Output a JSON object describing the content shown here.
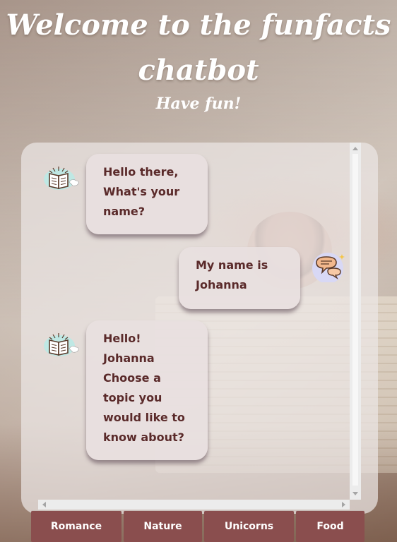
{
  "header": {
    "title": "Welcome to the funfacts chatbot",
    "subtitle": "Have fun!"
  },
  "chat": {
    "messages": [
      {
        "sender": "bot",
        "avatar_icon": "open-book-icon",
        "text": "Hello there,\nWhat's your name?"
      },
      {
        "sender": "user",
        "avatar_icon": "speech-bubbles-icon",
        "text": "My name is\nJohanna"
      },
      {
        "sender": "bot",
        "avatar_icon": "open-book-icon",
        "text": "Hello!\nJohanna\nChoose a topic you would like to know about?"
      }
    ]
  },
  "topics": [
    "Romance",
    "Nature",
    "Unicorns",
    "Food"
  ],
  "colors": {
    "button_bg": "#8a4e4e",
    "text": "#5a2a2a",
    "bubble_bg": "#e8e0e0"
  }
}
